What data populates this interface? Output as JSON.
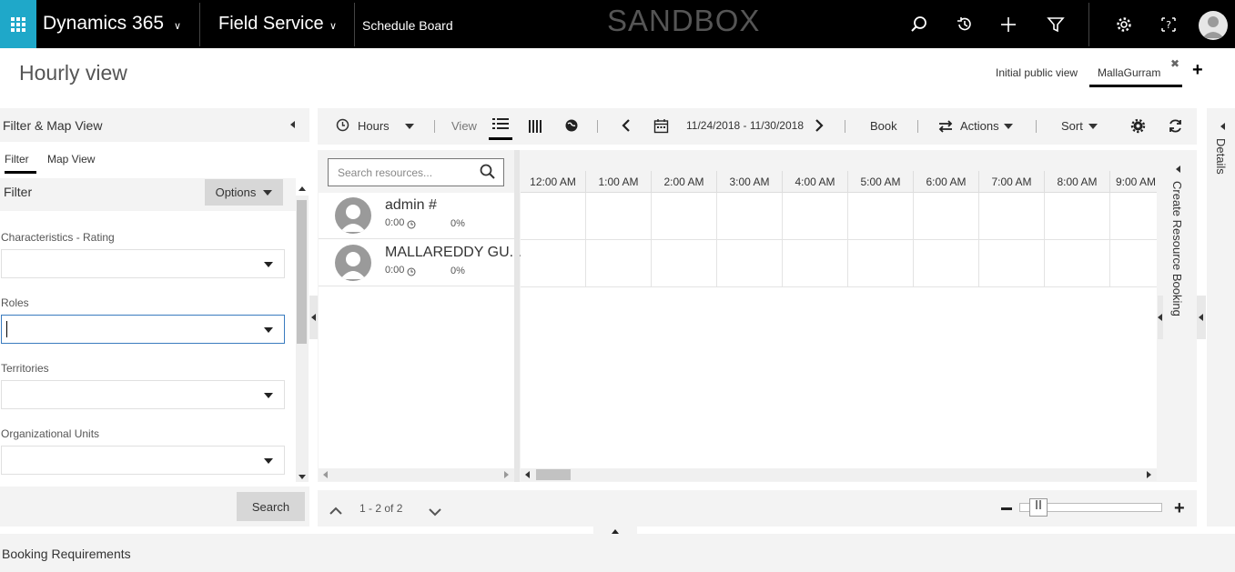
{
  "nav": {
    "app_name": "Dynamics 365",
    "area_name": "Field Service",
    "page_name": "Schedule Board",
    "environment": "SANDBOX"
  },
  "header": {
    "title": "Hourly view",
    "tabs": [
      {
        "label": "Initial public view"
      },
      {
        "label": "MallaGurram"
      }
    ]
  },
  "filter_panel": {
    "title": "Filter & Map View",
    "tabs": [
      "Filter",
      "Map View"
    ],
    "section_label": "Filter",
    "options_label": "Options",
    "fields": [
      {
        "label": "Characteristics - Rating",
        "value": ""
      },
      {
        "label": "Roles",
        "value": ""
      },
      {
        "label": "Territories",
        "value": ""
      },
      {
        "label": "Organizational Units",
        "value": ""
      }
    ],
    "search_label": "Search"
  },
  "toolbar": {
    "hours_label": "Hours",
    "view_label": "View",
    "date_range": "11/24/2018 - 11/30/2018",
    "book_label": "Book",
    "actions_label": "Actions",
    "sort_label": "Sort"
  },
  "resources": {
    "search_placeholder": "Search resources...",
    "rows": [
      {
        "name": "admin #",
        "hours": "0:00",
        "percent": "0%"
      },
      {
        "name": "MALLAREDDY GU...",
        "hours": "0:00",
        "percent": "0%"
      }
    ]
  },
  "timeline": {
    "hours": [
      "12:00 AM",
      "1:00 AM",
      "2:00 AM",
      "3:00 AM",
      "4:00 AM",
      "5:00 AM",
      "6:00 AM",
      "7:00 AM",
      "8:00 AM",
      "9:00 AM"
    ]
  },
  "side_panels": {
    "create_booking": "Create Resource Booking",
    "details": "Details"
  },
  "pager": {
    "label": "1 - 2 of 2"
  },
  "bottom": {
    "label": "Booking Requirements"
  },
  "colors": {
    "accent": "#1fa8c9",
    "topbar": "#000000",
    "panel_bg": "#f3f3f3"
  }
}
